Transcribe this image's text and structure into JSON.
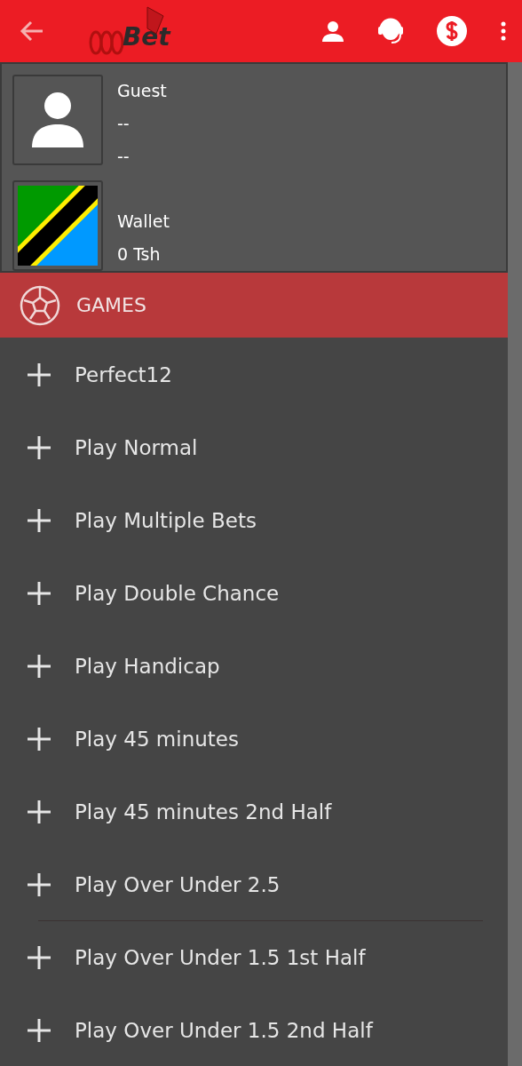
{
  "header": {
    "logo_text": "Bet"
  },
  "profile": {
    "name": "Guest",
    "line_2": "--",
    "line_3": "--",
    "wallet_label": "Wallet",
    "wallet_balance": "0 Tsh"
  },
  "section": {
    "title": "GAMES"
  },
  "menu_items": [
    {
      "label": "Perfect12",
      "divider_before": false
    },
    {
      "label": "Play Normal",
      "divider_before": false
    },
    {
      "label": "Play Multiple Bets",
      "divider_before": false
    },
    {
      "label": "Play Double Chance",
      "divider_before": false
    },
    {
      "label": "Play Handicap",
      "divider_before": false
    },
    {
      "label": "Play 45 minutes",
      "divider_before": false
    },
    {
      "label": "Play 45 minutes 2nd Half",
      "divider_before": false
    },
    {
      "label": "Play Over Under 2.5",
      "divider_before": false
    },
    {
      "label": "Play Over Under 1.5 1st Half",
      "divider_before": true
    },
    {
      "label": "Play Over Under 1.5 2nd Half",
      "divider_before": false
    }
  ]
}
